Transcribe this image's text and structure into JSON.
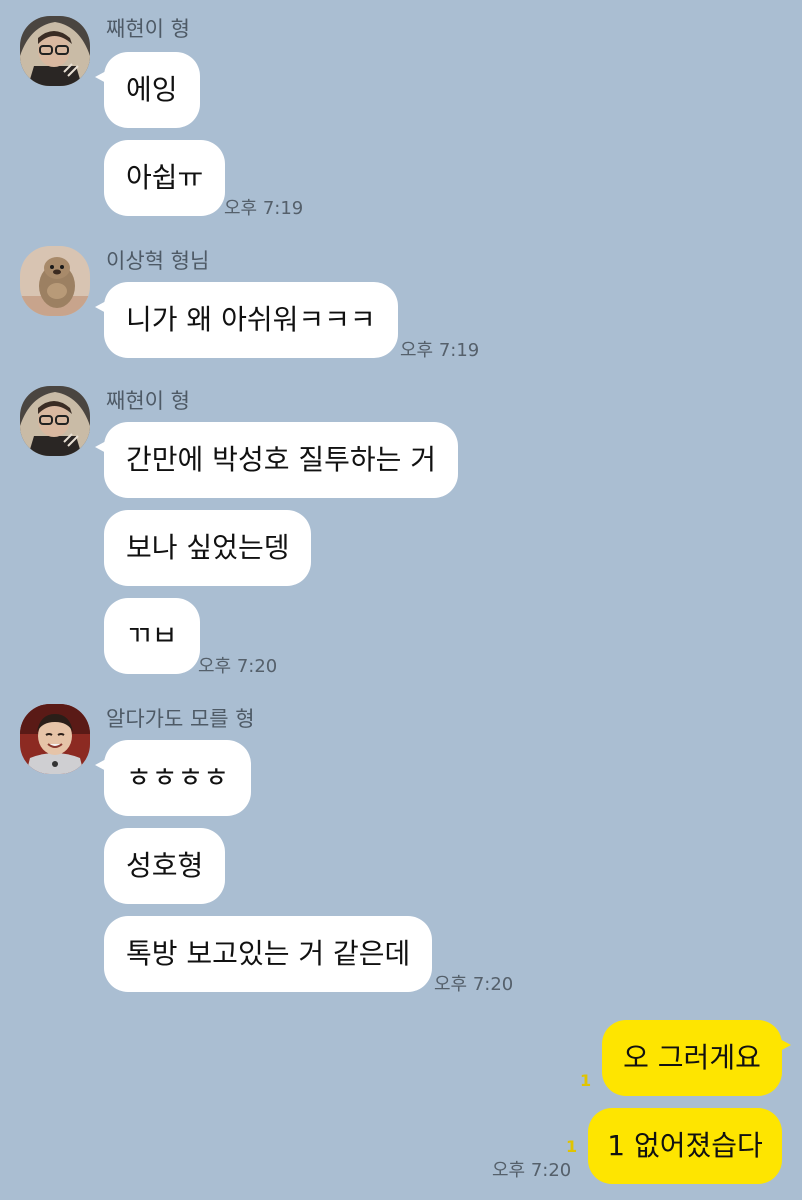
{
  "colors": {
    "background": "#aabed2",
    "incoming_bubble": "#ffffff",
    "outgoing_bubble": "#fee500",
    "unread_counter": "#e0c400"
  },
  "groups": [
    {
      "sender": "째현이 형",
      "avatar": "profile-photo-hooded-person",
      "messages": [
        "에잉",
        "아쉽ㅠ"
      ],
      "time": "오후 7:19"
    },
    {
      "sender": "이상혁 형님",
      "avatar": "profile-photo-otter-figure",
      "messages": [
        "니가 왜 아쉬워ㅋㅋㅋ"
      ],
      "time": "오후 7:19"
    },
    {
      "sender": "째현이 형",
      "avatar": "profile-photo-hooded-person",
      "messages": [
        "간만에 박성호 질투하는 거",
        "보나 싶었는뎅",
        "ㄲㅂ"
      ],
      "time": "오후 7:20"
    },
    {
      "sender": "알다가도 모를 형",
      "avatar": "profile-photo-child",
      "messages": [
        "ㅎㅎㅎㅎ",
        "성호형",
        "톡방 보고있는 거 같은데"
      ],
      "time": "오후 7:20"
    }
  ],
  "outgoing": {
    "messages": [
      {
        "text": "오 그러게요",
        "unread": "1"
      },
      {
        "text": "1 없어졌습다",
        "unread": "1"
      }
    ],
    "time": "오후 7:20"
  }
}
